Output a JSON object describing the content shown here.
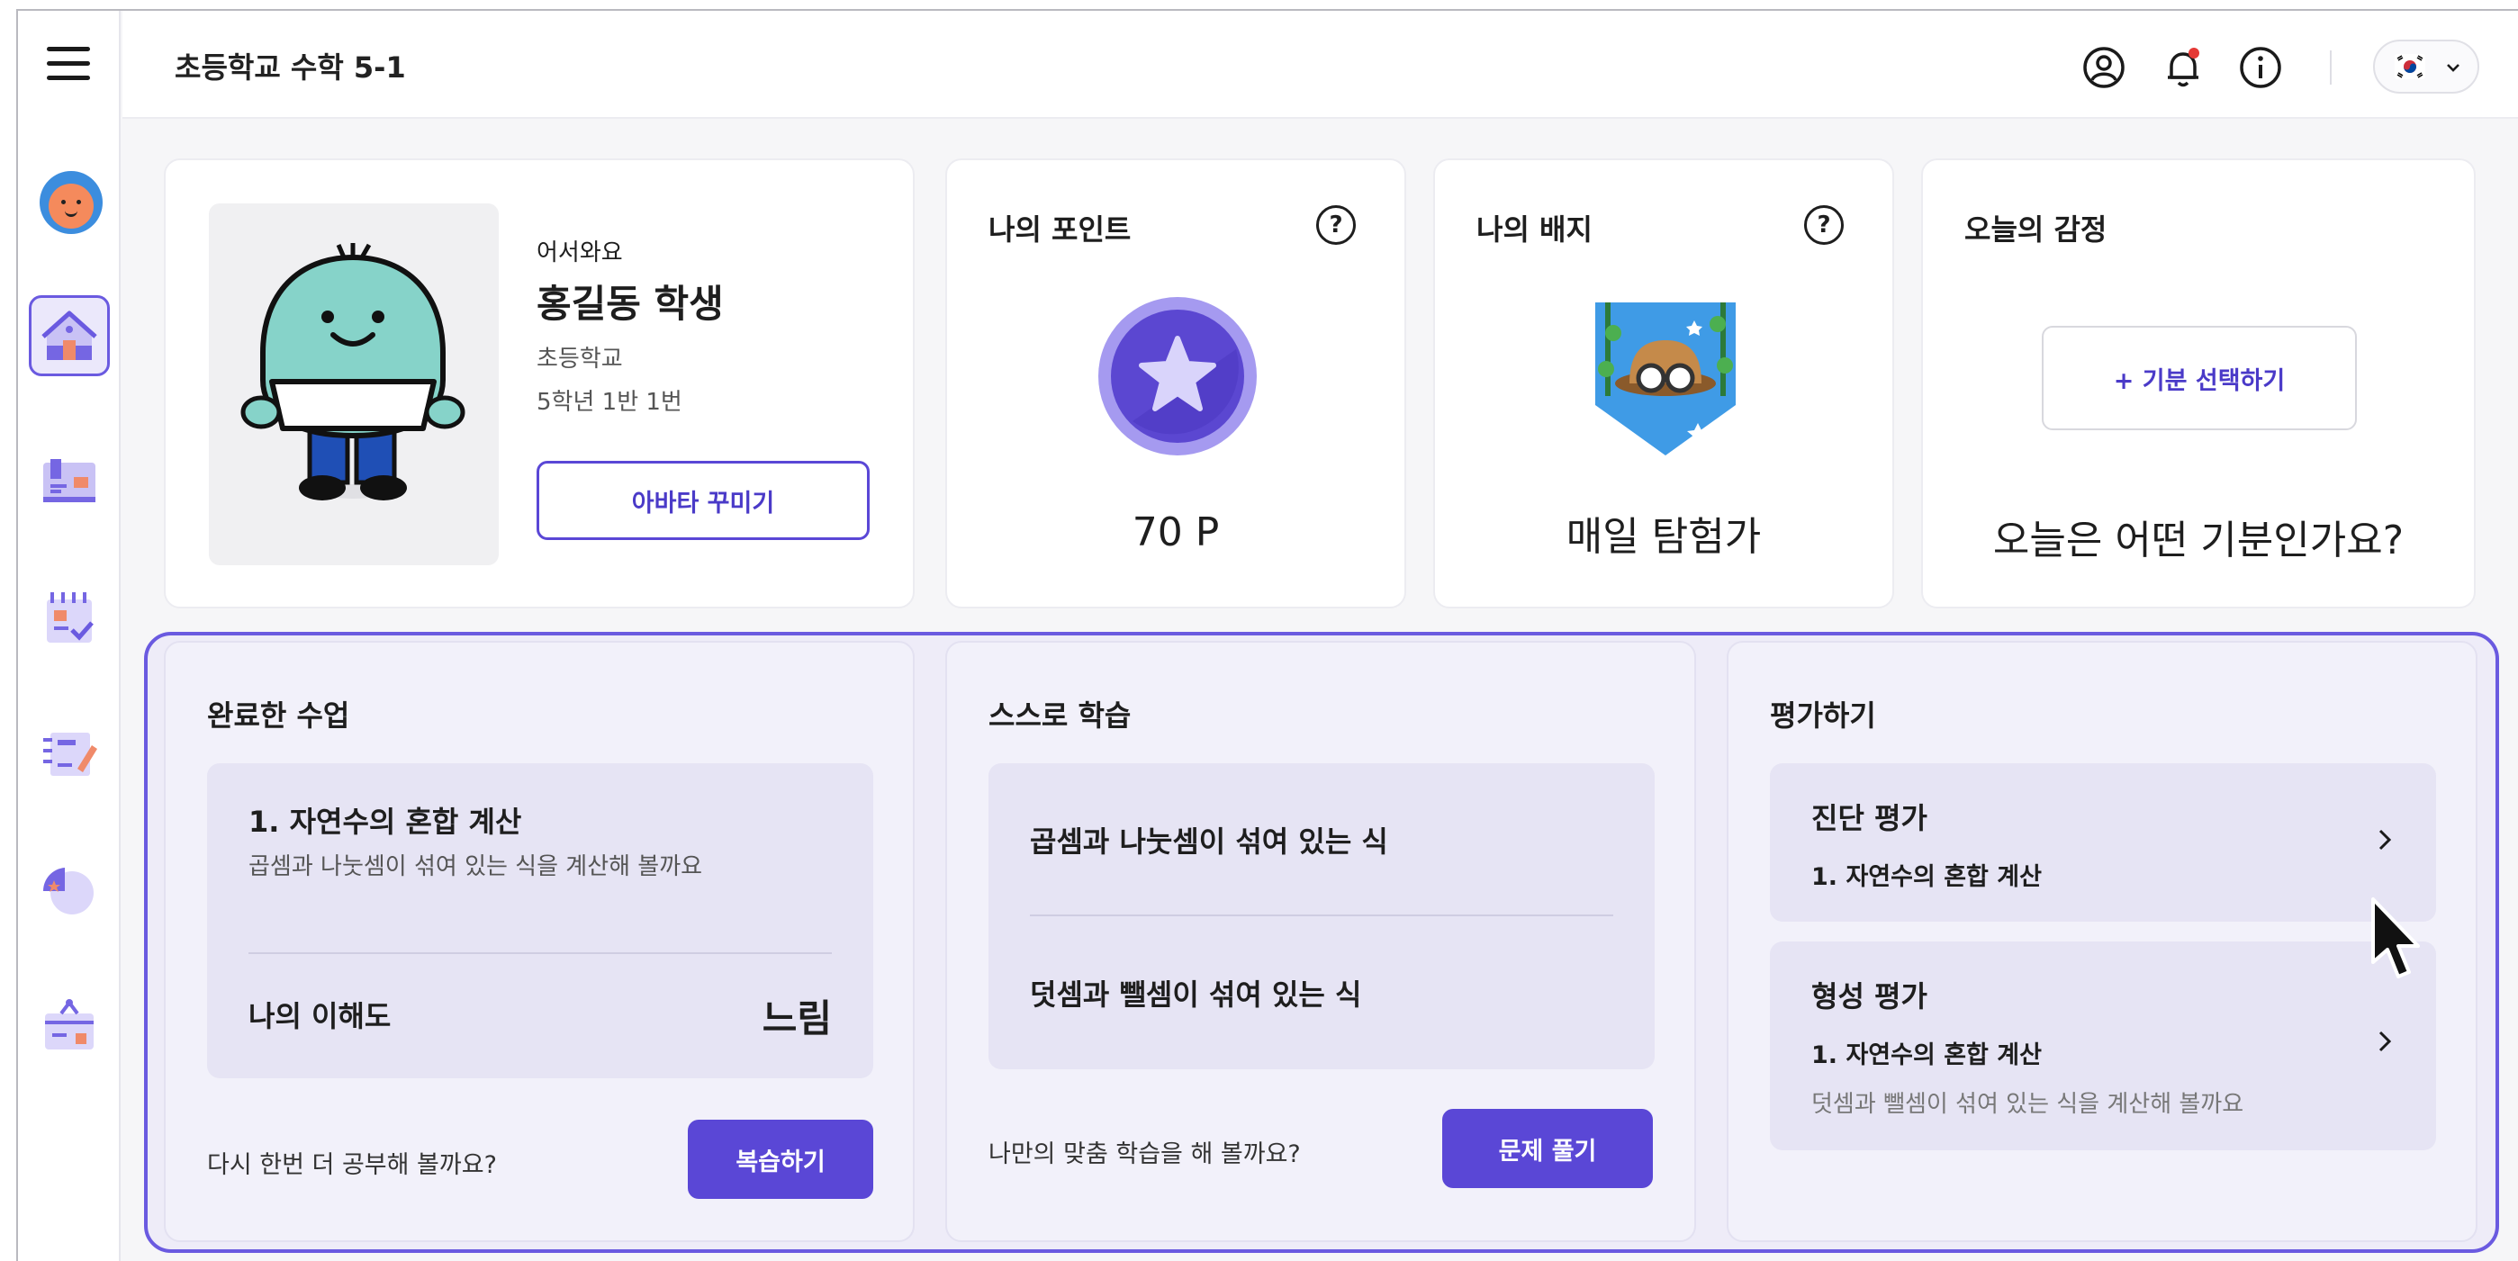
{
  "header": {
    "title": "초등학교 수학 5-1",
    "icons": [
      "user-circle-icon",
      "bell-icon",
      "info-icon"
    ],
    "language": "kr-flag-icon"
  },
  "sidebar": {
    "items": [
      "home-icon",
      "book-icon",
      "calendar-check-icon",
      "notebook-edit-icon",
      "pie-chart-icon",
      "briefcase-icon"
    ]
  },
  "profile": {
    "welcome": "어서와요",
    "name": "홍길동 학생",
    "school": "초등학교",
    "grade": "5학년 1반 1번",
    "avatar_button": "아바타 꾸미기"
  },
  "points": {
    "title": "나의 포인트",
    "help": "?",
    "value": "70 P"
  },
  "badge": {
    "title": "나의 배지",
    "help": "?",
    "name": "매일 탐험가"
  },
  "mood": {
    "title": "오늘의 감정",
    "button": "+ 기분 선택하기",
    "prompt": "오늘은 어떤 기분인가요?"
  },
  "completed": {
    "title": "완료한 수업",
    "lesson_title": "1. 자연수의 혼합 계산",
    "lesson_desc": "곱셈과 나눗셈이 섞여 있는 식을 계산해 볼까요",
    "understanding_label": "나의 이해도",
    "understanding_value": "느림",
    "footer_text": "다시 한번 더 공부해 볼까요?",
    "button": "복습하기"
  },
  "self_study": {
    "title": "스스로 학습",
    "items": [
      "곱셈과 나눗셈이 섞여 있는 식",
      "덧셈과 뺄셈이 섞여 있는 식"
    ],
    "footer_text": "나만의 맞춤 학습을 해 볼까요?",
    "button": "문제 풀기"
  },
  "assessment": {
    "title": "평가하기",
    "diagnostic": {
      "title": "진단 평가",
      "subtitle": "1. 자연수의 혼합 계산"
    },
    "formative": {
      "title": "형성 평가",
      "subtitle": "1. 자연수의 혼합 계산",
      "desc": "덧셈과 뺄셈이 섞여 있는 식을 계산해 볼까요"
    }
  },
  "colors": {
    "accent": "#5a47d6",
    "highlight_border": "#6a5ae0",
    "panel_bg": "#eeecf8"
  }
}
